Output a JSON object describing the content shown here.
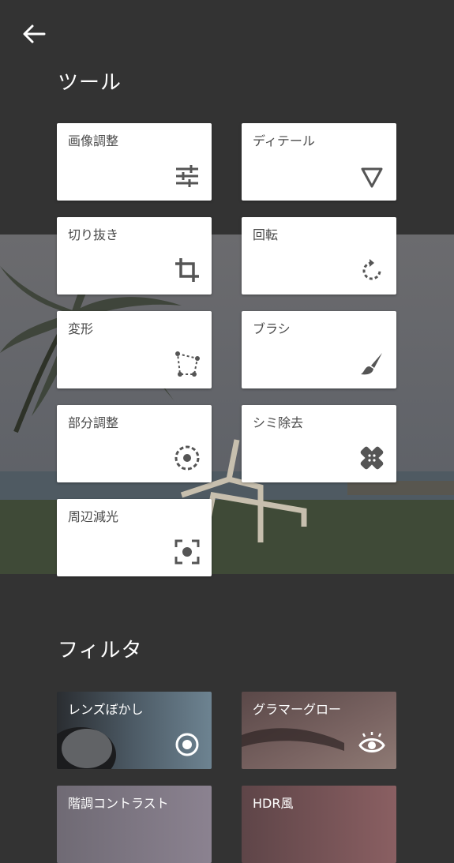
{
  "header": {
    "back_icon": "arrow-left-icon"
  },
  "tools": {
    "title": "ツール",
    "items": [
      {
        "label": "画像調整",
        "icon": "tune-sliders-icon"
      },
      {
        "label": "ディテール",
        "icon": "triangle-down-icon"
      },
      {
        "label": "切り抜き",
        "icon": "crop-icon"
      },
      {
        "label": "回転",
        "icon": "rotate-icon"
      },
      {
        "label": "変形",
        "icon": "perspective-icon"
      },
      {
        "label": "ブラシ",
        "icon": "brush-icon"
      },
      {
        "label": "部分調整",
        "icon": "selective-target-icon"
      },
      {
        "label": "シミ除去",
        "icon": "healing-bandage-icon"
      },
      {
        "label": "周辺減光",
        "icon": "vignette-focus-icon"
      }
    ]
  },
  "filters": {
    "title": "フィルタ",
    "items": [
      {
        "label": "レンズぼかし",
        "icon": "lens-blur-icon"
      },
      {
        "label": "グラマーグロー",
        "icon": "eye-icon"
      },
      {
        "label": "階調コントラスト",
        "icon": ""
      },
      {
        "label": "HDR風",
        "icon": ""
      }
    ]
  },
  "colors": {
    "background": "#333333",
    "tile": "#ffffff",
    "icon": "#555555"
  }
}
